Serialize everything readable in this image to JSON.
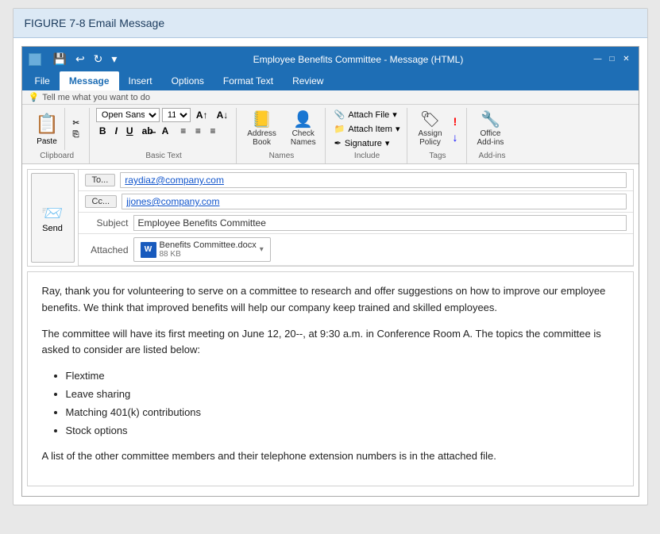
{
  "figure": {
    "title_bold": "FIGURE 7-8",
    "title_normal": " Email Message"
  },
  "titlebar": {
    "title": "Employee Benefits Committee - Message (HTML)",
    "save_btn": "💾",
    "undo_btn": "↩",
    "redo_btn": "↻",
    "customize_btn": "▾",
    "min_btn": "—",
    "restore_btn": "□",
    "close_btn": "✕"
  },
  "tabs": [
    {
      "label": "File",
      "active": false
    },
    {
      "label": "Message",
      "active": true
    },
    {
      "label": "Insert",
      "active": false
    },
    {
      "label": "Options",
      "active": false
    },
    {
      "label": "Format Text",
      "active": false
    },
    {
      "label": "Review",
      "active": false
    }
  ],
  "tellme": {
    "icon": "💡",
    "text": "Tell me what you want to do"
  },
  "ribbon": {
    "clipboard": {
      "label": "Clipboard",
      "paste_label": "Paste",
      "cut_label": "✂",
      "copy_label": "⎘"
    },
    "basic_text": {
      "label": "Basic Text",
      "font": "Open Sans",
      "size": "11",
      "bold": "B",
      "italic": "I",
      "underline": "U"
    },
    "names": {
      "label": "Names",
      "address_book": "Address\nBook",
      "check_names": "Check\nNames"
    },
    "include": {
      "label": "Include",
      "attach_file": "Attach File",
      "attach_item": "Attach Item",
      "signature": "Signature"
    },
    "tags": {
      "label": "Tags",
      "assign_policy": "Assign\nPolicy"
    },
    "addins": {
      "label": "Add-ins",
      "office_addins": "Office\nAdd-ins"
    }
  },
  "compose": {
    "to_label": "To...",
    "to_value": "raydiaz@company.com",
    "cc_label": "Cc...",
    "cc_value": "jjones@company.com",
    "subject_label": "Subject",
    "subject_value": "Employee Benefits Committee",
    "attached_label": "Attached",
    "attachment_name": "Benefits Committee.docx",
    "attachment_size": "88 KB"
  },
  "body": {
    "paragraph1": "Ray, thank you for volunteering to serve on a committee to research and offer suggestions on how to improve our employee benefits. We think that improved benefits will help our company keep trained and skilled employees.",
    "paragraph2": "The committee will have its first meeting on June 12, 20--, at 9:30 a.m. in Conference Room A. The topics the committee is asked to consider are listed below:",
    "bullet1": "Flextime",
    "bullet2": "Leave sharing",
    "bullet3": "Matching 401(k) contributions",
    "bullet4": "Stock options",
    "paragraph3": "A list of the other committee members and their telephone extension numbers is in the attached file."
  }
}
